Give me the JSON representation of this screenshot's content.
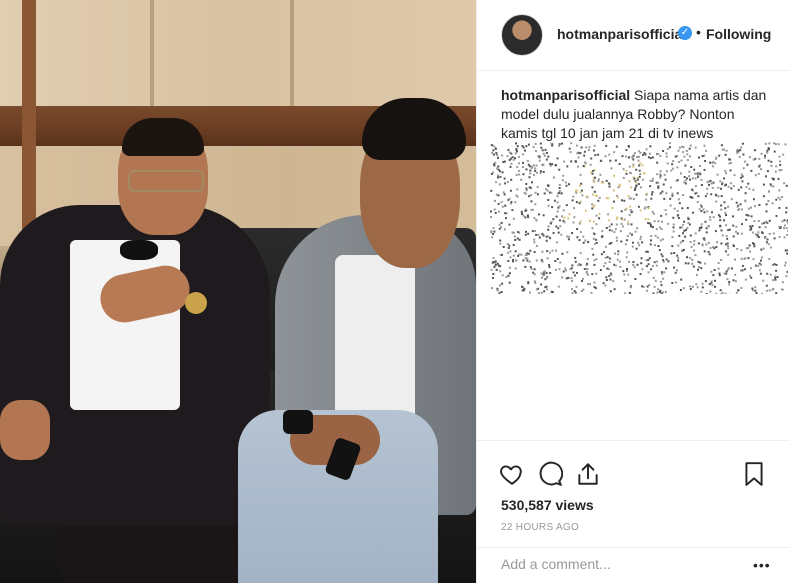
{
  "post": {
    "username": "hotmanparisofficial",
    "verified": true,
    "follow_state": "Following",
    "separator": "•",
    "caption": "Siapa nama artis dan model dulu jualannya Robby? Nonton kamis tgl 10 jan jam 21 di tv inews",
    "views": "530,587 views",
    "timestamp": "22 HOURS AGO"
  },
  "comment": {
    "placeholder": "Add a comment...",
    "more": "•••"
  },
  "icons": {
    "like": "heart-icon",
    "comment": "comment-bubble-icon",
    "share": "share-icon",
    "save": "bookmark-icon",
    "verified": "verified-badge-icon"
  },
  "colors": {
    "text": "#262626",
    "muted": "#999999",
    "verified": "#3897f0",
    "border": "#efefef"
  }
}
